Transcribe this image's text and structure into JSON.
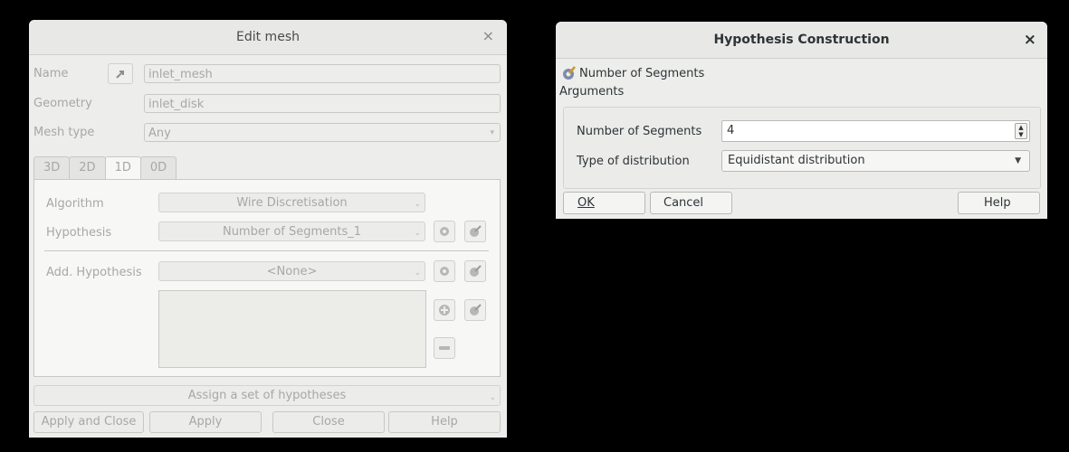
{
  "edit_mesh": {
    "title": "Edit mesh",
    "close_glyph": "×",
    "name_label": "Name",
    "name_value": "inlet_mesh",
    "geometry_label": "Geometry",
    "geometry_value": "inlet_disk",
    "mesh_type_label": "Mesh type",
    "mesh_type_value": "Any",
    "tabs": [
      {
        "label": "3D"
      },
      {
        "label": "2D"
      },
      {
        "label": "1D"
      },
      {
        "label": "0D"
      }
    ],
    "active_tab": "1D",
    "algorithm_label": "Algorithm",
    "algorithm_value": "Wire Discretisation",
    "hypothesis_label": "Hypothesis",
    "hypothesis_value": "Number of Segments_1",
    "add_hypothesis_label": "Add. Hypothesis",
    "add_hypothesis_value": "<None>",
    "assign_set_label": "Assign a set of hypotheses",
    "buttons": {
      "apply_close": "Apply and Close",
      "apply": "Apply",
      "close": "Close",
      "help": "Help"
    }
  },
  "hypothesis": {
    "title": "Hypothesis Construction",
    "close_glyph": "×",
    "hypothesis_type": "Number of Segments",
    "arguments_label": "Arguments",
    "num_segments_label": "Number of Segments",
    "num_segments_value": "4",
    "distribution_label": "Type of distribution",
    "distribution_value": "Equidistant distribution",
    "buttons": {
      "ok": "OK",
      "cancel": "Cancel",
      "help": "Help"
    }
  }
}
